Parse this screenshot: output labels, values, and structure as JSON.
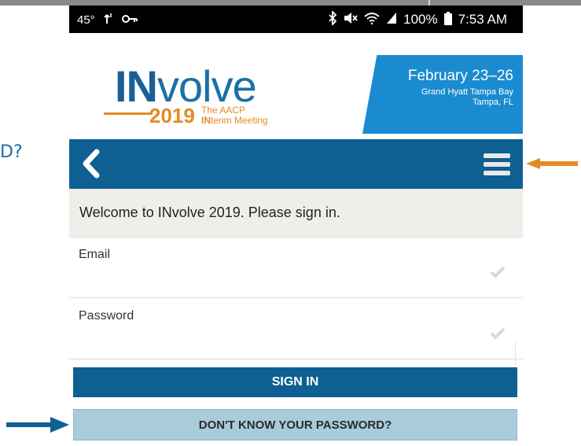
{
  "side_text": "D?",
  "statusbar": {
    "temp": "45°",
    "signal_left": "1̓",
    "key_icon": "key-icon",
    "right_icons": "✱ ✖ ◠",
    "battery": "100%",
    "time": "7:53 AM"
  },
  "banner": {
    "logo_in": "IN",
    "logo_volve": "volve",
    "logo_year": "2019",
    "logo_sub1": "The AACP",
    "logo_sub2_bold": "IN",
    "logo_sub2_rest": "terim Meeting",
    "date": "February 23–26",
    "venue": "Grand Hyatt Tampa Bay",
    "city": "Tampa, FL"
  },
  "welcome": "Welcome to INvolve 2019. Please sign in.",
  "form": {
    "email_label": "Email",
    "email_value": "",
    "password_label": "Password",
    "password_value": ""
  },
  "buttons": {
    "sign_in": "SIGN IN",
    "forgot": "DON'T KNOW YOUR PASSWORD?"
  },
  "colors": {
    "navbar": "#0e5f92",
    "accent_orange": "#e58a24",
    "forgot_button": "#a8ccd9",
    "arrow_blue": "#0e5f92"
  }
}
